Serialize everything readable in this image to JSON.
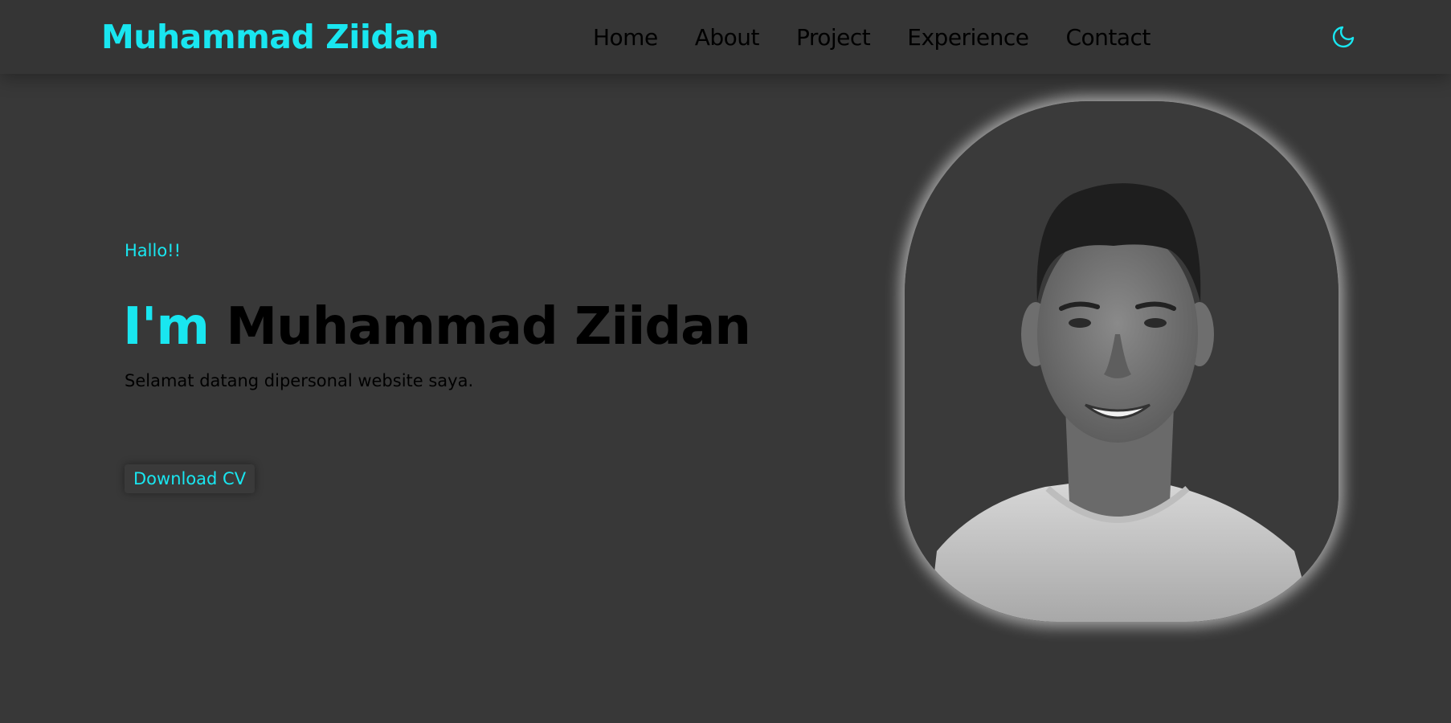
{
  "navbar": {
    "brand": "Muhammad Ziidan",
    "links": [
      {
        "label": "Home"
      },
      {
        "label": "About"
      },
      {
        "label": "Project"
      },
      {
        "label": "Experience"
      },
      {
        "label": "Contact"
      }
    ],
    "theme_toggle_icon": "moon-icon"
  },
  "hero": {
    "greeting": "Hallo!!",
    "headline_prefix": "I'm",
    "headline_name": "Muhammad Ziidan",
    "subtitle": "Selamat datang dipersonal website saya.",
    "cv_button": "Download CV",
    "portrait_icon": "profile-photo"
  },
  "colors": {
    "accent": "#19e6f0",
    "background": "#383838",
    "navbar": "#353535",
    "text": "#000000"
  }
}
